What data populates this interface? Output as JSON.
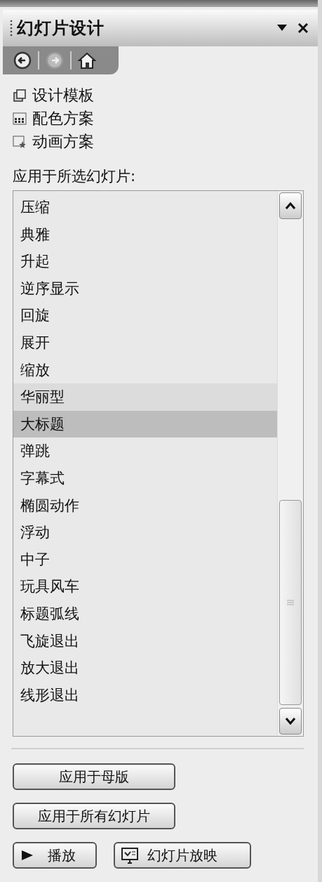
{
  "pane": {
    "title": "幻灯片设计"
  },
  "nav": [
    {
      "kind": "back",
      "disabled": false
    },
    {
      "kind": "forward",
      "disabled": true
    },
    {
      "kind": "home",
      "disabled": false
    }
  ],
  "links": [
    {
      "kind": "template",
      "label": "设计模板"
    },
    {
      "kind": "colors",
      "label": "配色方案"
    },
    {
      "kind": "animation",
      "label": "动画方案"
    }
  ],
  "list_label": "应用于所选幻灯片:",
  "schemes": [
    {
      "label": "压缩",
      "selected": false,
      "hovered": false
    },
    {
      "label": "典雅",
      "selected": false,
      "hovered": false
    },
    {
      "label": "升起",
      "selected": false,
      "hovered": false
    },
    {
      "label": "逆序显示",
      "selected": false,
      "hovered": false
    },
    {
      "label": "回旋",
      "selected": false,
      "hovered": false
    },
    {
      "label": "展开",
      "selected": false,
      "hovered": false
    },
    {
      "label": "缩放",
      "selected": false,
      "hovered": false
    },
    {
      "label": "华丽型",
      "selected": false,
      "hovered": true
    },
    {
      "label": "大标题",
      "selected": true,
      "hovered": false
    },
    {
      "label": "弹跳",
      "selected": false,
      "hovered": false
    },
    {
      "label": "字幕式",
      "selected": false,
      "hovered": false
    },
    {
      "label": "椭圆动作",
      "selected": false,
      "hovered": false
    },
    {
      "label": "浮动",
      "selected": false,
      "hovered": false
    },
    {
      "label": "中子",
      "selected": false,
      "hovered": false
    },
    {
      "label": "玩具风车",
      "selected": false,
      "hovered": false
    },
    {
      "label": "标题弧线",
      "selected": false,
      "hovered": false
    },
    {
      "label": "飞旋退出",
      "selected": false,
      "hovered": false
    },
    {
      "label": "放大退出",
      "selected": false,
      "hovered": false
    },
    {
      "label": "线形退出",
      "selected": false,
      "hovered": false
    }
  ],
  "buttons": [
    {
      "label": "应用于母版"
    },
    {
      "label": "应用于所有幻灯片"
    }
  ],
  "play_buttons": [
    {
      "kind": "play",
      "label": "播放"
    },
    {
      "kind": "slideshow",
      "label": "幻灯片放映"
    }
  ]
}
